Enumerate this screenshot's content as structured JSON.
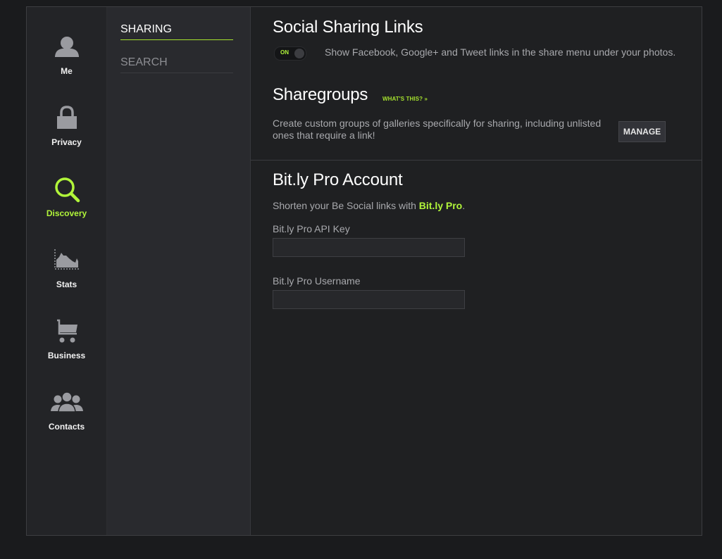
{
  "nav": {
    "items": [
      {
        "label": "Me",
        "icon": "user-icon",
        "active": false
      },
      {
        "label": "Privacy",
        "icon": "lock-icon",
        "active": false
      },
      {
        "label": "Discovery",
        "icon": "search-icon",
        "active": true
      },
      {
        "label": "Stats",
        "icon": "chart-icon",
        "active": false
      },
      {
        "label": "Business",
        "icon": "cart-icon",
        "active": false
      },
      {
        "label": "Contacts",
        "icon": "contacts-icon",
        "active": false
      }
    ]
  },
  "submenu": {
    "items": [
      {
        "label": "SHARING",
        "active": true
      },
      {
        "label": "SEARCH",
        "active": false
      }
    ]
  },
  "social": {
    "title": "Social Sharing Links",
    "toggle_label": "ON",
    "toggle_state": "on",
    "description": "Show Facebook, Google+ and Tweet links in the share menu under your photos."
  },
  "sharegroups": {
    "title": "Sharegroups",
    "whats_this": "WHAT'S THIS? »",
    "description_line1": "Create custom groups of galleries specifically for sharing, including unlisted",
    "description_line2": "ones that require a link!",
    "manage_label": "MANAGE"
  },
  "bitly": {
    "title": "Bit.ly Pro Account",
    "description_prefix": "Shorten your Be Social links with ",
    "description_link": "Bit.ly Pro",
    "description_suffix": ".",
    "api_key_label": "Bit.ly Pro API Key",
    "api_key_value": "",
    "username_label": "Bit.ly Pro Username",
    "username_value": ""
  },
  "colors": {
    "accent": "#b1f53a",
    "background": "#1f2022",
    "rail": "#232427",
    "submenu": "#292a2e"
  }
}
